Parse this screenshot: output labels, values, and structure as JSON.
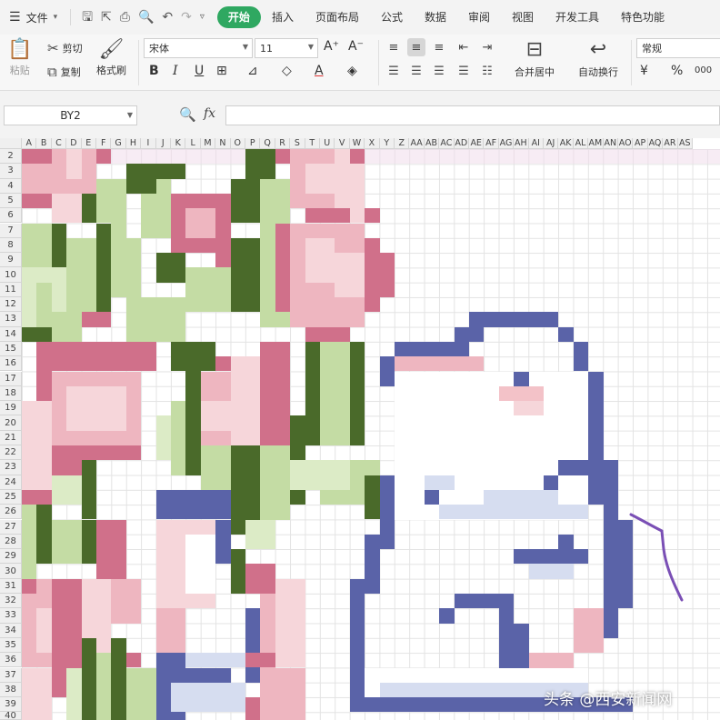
{
  "menu": {
    "file_label": "文件",
    "tabs": [
      {
        "label": "开始",
        "active": true
      },
      {
        "label": "插入",
        "active": false
      },
      {
        "label": "页面布局",
        "active": false
      },
      {
        "label": "公式",
        "active": false
      },
      {
        "label": "数据",
        "active": false
      },
      {
        "label": "审阅",
        "active": false
      },
      {
        "label": "视图",
        "active": false
      },
      {
        "label": "开发工具",
        "active": false
      },
      {
        "label": "特色功能",
        "active": false
      }
    ],
    "accent_color": "#2fa861"
  },
  "ribbon": {
    "paste_label": "粘贴",
    "cut_label": "剪切",
    "copy_label": "复制",
    "format_painter_label": "格式刷",
    "font_name": "宋体",
    "font_size": "11",
    "merge_center_label": "合并居中",
    "wrap_text_label": "自动换行",
    "number_format": "常规",
    "percent_symbol": "%",
    "decimal_symbol": "000"
  },
  "formula_bar": {
    "name_box": "BY2",
    "fx_label": "fx",
    "formula": ""
  },
  "sheet": {
    "columns": [
      "A",
      "B",
      "C",
      "D",
      "E",
      "F",
      "G",
      "H",
      "I",
      "J",
      "K",
      "L",
      "M",
      "N",
      "O",
      "P",
      "Q",
      "R",
      "S",
      "T",
      "U",
      "V",
      "W",
      "X",
      "Y",
      "Z",
      "AA",
      "AB",
      "AC",
      "AD",
      "AE",
      "AF",
      "AG",
      "AH",
      "AI",
      "AJ",
      "AK",
      "AL",
      "AM",
      "AN",
      "AO",
      "AP",
      "AQ",
      "AR",
      "AS"
    ],
    "rows": [
      "2",
      "3",
      "4",
      "5",
      "6",
      "7",
      "8",
      "9",
      "10",
      "11",
      "12",
      "13",
      "14",
      "15",
      "16",
      "17",
      "18",
      "19",
      "20",
      "21",
      "22",
      "23",
      "24",
      "25",
      "26",
      "27",
      "28",
      "29",
      "30",
      "31",
      "32",
      "33",
      "34",
      "35",
      "36",
      "37",
      "38",
      "39",
      "40"
    ],
    "palette": {
      "dark_green": "#4a6a2a",
      "light_green": "#c4dca4",
      "pale_green": "#dcebc6",
      "rose": "#d0708a",
      "light_pink": "#eeb6c0",
      "pale_pink": "#f6d6da",
      "blush": "#f3c2c8",
      "navy": "#5a63a8",
      "light_blue": "#d6ddf0"
    }
  },
  "watermark": {
    "text": "头条 @西安新闻网"
  }
}
